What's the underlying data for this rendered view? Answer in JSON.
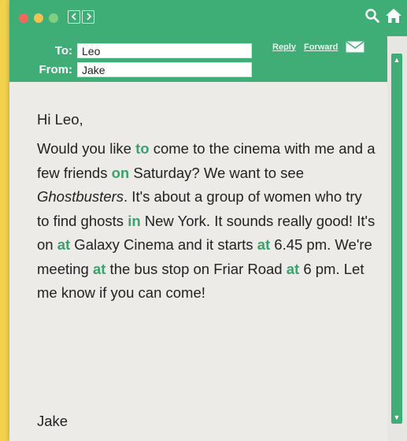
{
  "colors": {
    "accent": "#3fae76",
    "highlight": "#3aa36c"
  },
  "email": {
    "to_label": "To:",
    "to_value": "Leo",
    "from_label": "From:",
    "from_value": "Jake",
    "reply_label": "Reply",
    "forward_label": "Forward",
    "greeting": "Hi Leo,",
    "body": {
      "s1": "Would you like ",
      "w1": "to",
      "s2": " come to the cinema with me and a few friends ",
      "w2": "on",
      "s3": " Saturday? We want to see ",
      "movie": "Ghostbusters",
      "s4": ". It's about a group of women who try to find ghosts ",
      "w3": "in",
      "s5": " New York. It sounds really good! It's on ",
      "w4": "at",
      "s6": " Galaxy Cinema and it starts ",
      "w5": "at",
      "s7": " 6.45 pm. We're meeting ",
      "w6": "at",
      "s8": " the bus stop on Friar Road ",
      "w7": "at",
      "s9": " 6 pm. Let me know if you can come!"
    },
    "signoff": "Jake"
  },
  "icons": {
    "search": "search-icon",
    "home": "home-icon",
    "mail": "envelope-icon",
    "back": "chevron-left-icon",
    "forward_nav": "chevron-right-icon"
  }
}
